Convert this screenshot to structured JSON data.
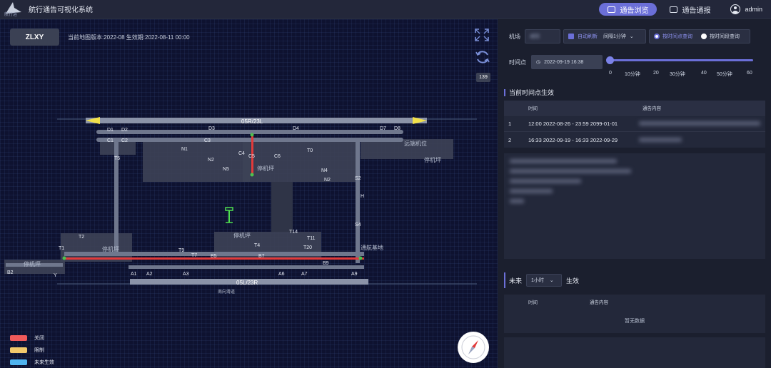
{
  "app": {
    "title": "航行通告可视化系统",
    "logo_text": "航行运"
  },
  "nav": {
    "browse_label": "通告浏览",
    "report_label": "通告通报",
    "user": "admin"
  },
  "map": {
    "airport_code": "ZLXY",
    "version_text": "当前地图版本:2022-08  生效期:2022-08-11 00:00",
    "zoom_level": "139",
    "runway_north": "05R/23L",
    "runway_south": "05L/23R",
    "labels": {
      "d1": "D1",
      "d2": "D2",
      "d3": "D3",
      "d4": "D4",
      "d7": "D7",
      "d8": "D8",
      "c1": "C1",
      "c2": "C2",
      "c3": "C3",
      "c4": "C4",
      "c5": "C5",
      "c6": "C6",
      "n1": "N1",
      "n2": "N2",
      "n4": "N4",
      "n5": "N5",
      "t0": "T0",
      "t1": "T1",
      "t2": "T2",
      "t4": "T4",
      "t5": "T5",
      "t7": "T7",
      "t9": "T9",
      "t11": "T11",
      "t14": "T14",
      "t20": "T20",
      "b2": "B2",
      "b5": "B5",
      "b7": "B7",
      "b9": "B9",
      "a1": "A1",
      "a2": "A2",
      "a3": "A3",
      "a6": "A6",
      "a7": "A7",
      "a9": "A9",
      "s2": "S2",
      "s4": "S4",
      "h": "H",
      "y": "Y",
      "apron1": "停机坪",
      "apron2": "停机坪",
      "apron3": "停机坪",
      "apron4": "停机坪",
      "apron5": "停机坪",
      "base": "通航基地",
      "remote": "远端机位",
      "south": "南向滑道"
    }
  },
  "legend": [
    {
      "label": "关闭",
      "color": "#f05a5a"
    },
    {
      "label": "限制",
      "color": "#f2c96b"
    },
    {
      "label": "未来生效",
      "color": "#4fb3ef"
    }
  ],
  "filters": {
    "airport_label": "机场",
    "airport_value": "咸阳",
    "auto_refresh_label": "自动刷新",
    "interval_value": "间隔1分钟",
    "mode_point_label": "按时间点查询",
    "mode_range_label": "按时间段查询",
    "time_label": "时间点",
    "time_value": "2022-09-19 16:38",
    "ticks": [
      "0",
      "10分钟",
      "20",
      "30分钟",
      "40",
      "50分钟",
      "60"
    ],
    "slider_value_minutes": 0
  },
  "current_section": {
    "title": "当前时间点生效",
    "columns": [
      "时间",
      "通告内容"
    ],
    "rows": [
      {
        "index": "1",
        "time": "12:00 2022-08-26 - 23:59 2099-01-01"
      },
      {
        "index": "2",
        "time": "16:33 2022-09-19 - 16:33 2022-09-29"
      }
    ]
  },
  "future_section": {
    "prefix": "未来",
    "range_value": "1小时",
    "suffix": "生效",
    "columns": [
      "时间",
      "通告内容"
    ],
    "empty_text": "暂无数据"
  },
  "colors": {
    "accent": "#6b6fd8",
    "closed": "#f05a5a",
    "restricted": "#f2c96b",
    "future": "#4fb3ef",
    "taxi_closed": "#e23a3a"
  }
}
